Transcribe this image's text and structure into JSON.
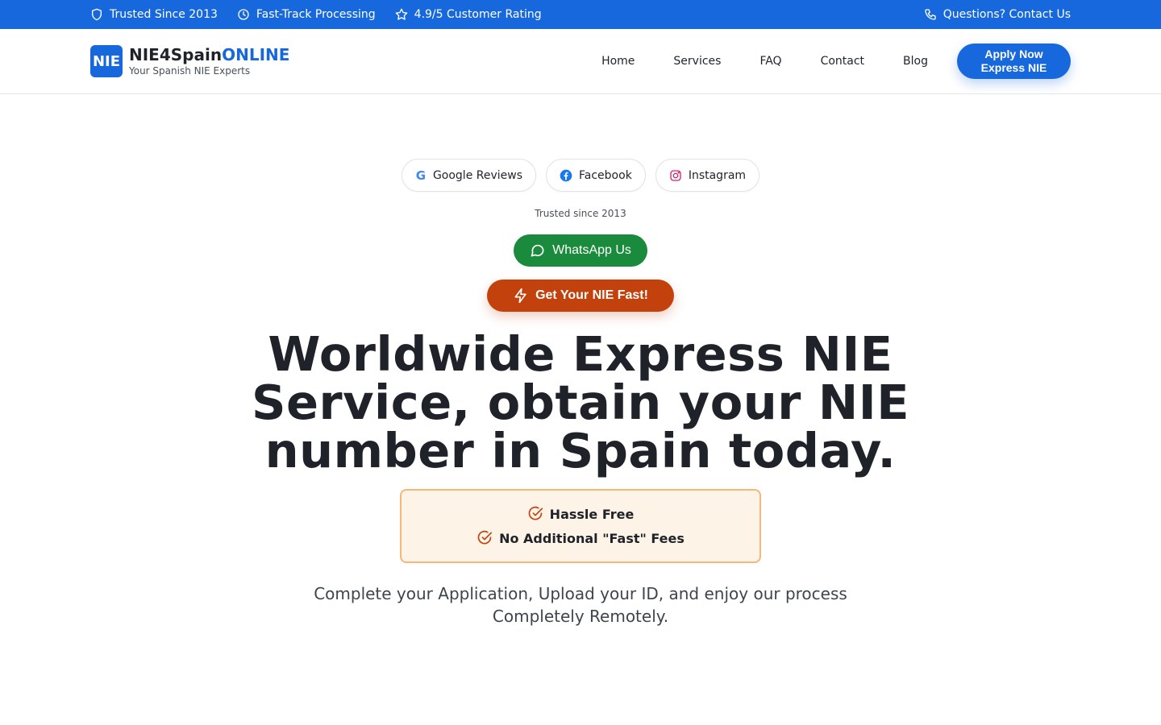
{
  "topbar": {
    "trusted": "Trusted Since 2013",
    "processing": "Fast-Track Processing",
    "rating": "4.9/5 Customer Rating",
    "contact": "Questions? Contact Us"
  },
  "header": {
    "logo_badge": "NIE",
    "brand_main": "NIE4Spain",
    "brand_highlight": "ONLINE",
    "tagline": "Your Spanish NIE Experts",
    "nav": [
      "Home",
      "Services",
      "FAQ",
      "Contact",
      "Blog"
    ],
    "apply_line1": "Apply Now",
    "apply_line2": "Express NIE"
  },
  "hero": {
    "social": {
      "google": "Google Reviews",
      "google_letter": "G",
      "facebook": "Facebook",
      "instagram": "Instagram"
    },
    "trusted": "Trusted since 2013",
    "whatsapp": "WhatsApp Us",
    "cta": "Get Your NIE Fast!",
    "headline": "Worldwide Express NIE Service, obtain your NIE number in Spain today.",
    "benefits": [
      "Hassle Free",
      "No Additional \"Fast\" Fees"
    ],
    "subtext": "Complete your Application, Upload your ID, and enjoy our process Completely Remotely."
  },
  "colors": {
    "primary": "#1668dc",
    "whatsapp": "#1a8a3c",
    "cta": "#c2410c",
    "benefit_border": "#f5b87a",
    "benefit_bg": "#fdf3e7"
  }
}
